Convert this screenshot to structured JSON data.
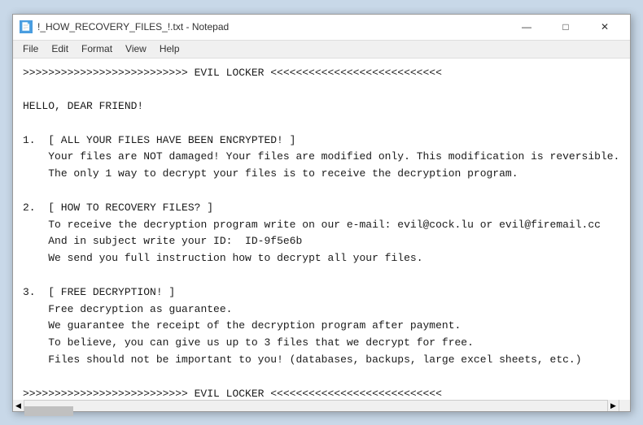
{
  "window": {
    "title": "!_HOW_RECOVERY_FILES_!.txt - Notepad",
    "icon": "📄"
  },
  "menu": {
    "items": [
      "File",
      "Edit",
      "Format",
      "View",
      "Help"
    ]
  },
  "controls": {
    "minimize": "—",
    "maximize": "□",
    "close": "✕"
  },
  "content": {
    "text": ">>>>>>>>>>>>>>>>>>>>>>>>>> EVIL LOCKER <<<<<<<<<<<<<<<<<<<<<<<<<<<\n\nHELLO, DEAR FRIEND!\n\n1.  [ ALL YOUR FILES HAVE BEEN ENCRYPTED! ]\n    Your files are NOT damaged! Your files are modified only. This modification is reversible.\n    The only 1 way to decrypt your files is to receive the decryption program.\n\n2.  [ HOW TO RECOVERY FILES? ]\n    To receive the decryption program write on our e-mail: evil@cock.lu or evil@firemail.cc\n    And in subject write your ID:  ID-9f5e6b\n    We send you full instruction how to decrypt all your files.\n\n3.  [ FREE DECRYPTION! ]\n    Free decryption as guarantee.\n    We guarantee the receipt of the decryption program after payment.\n    To believe, you can give us up to 3 files that we decrypt for free.\n    Files should not be important to you! (databases, backups, large excel sheets, etc.)\n\n>>>>>>>>>>>>>>>>>>>>>>>>>> EVIL LOCKER <<<<<<<<<<<<<<<<<<<<<<<<<<<"
  },
  "statusbar": {
    "info": ""
  }
}
